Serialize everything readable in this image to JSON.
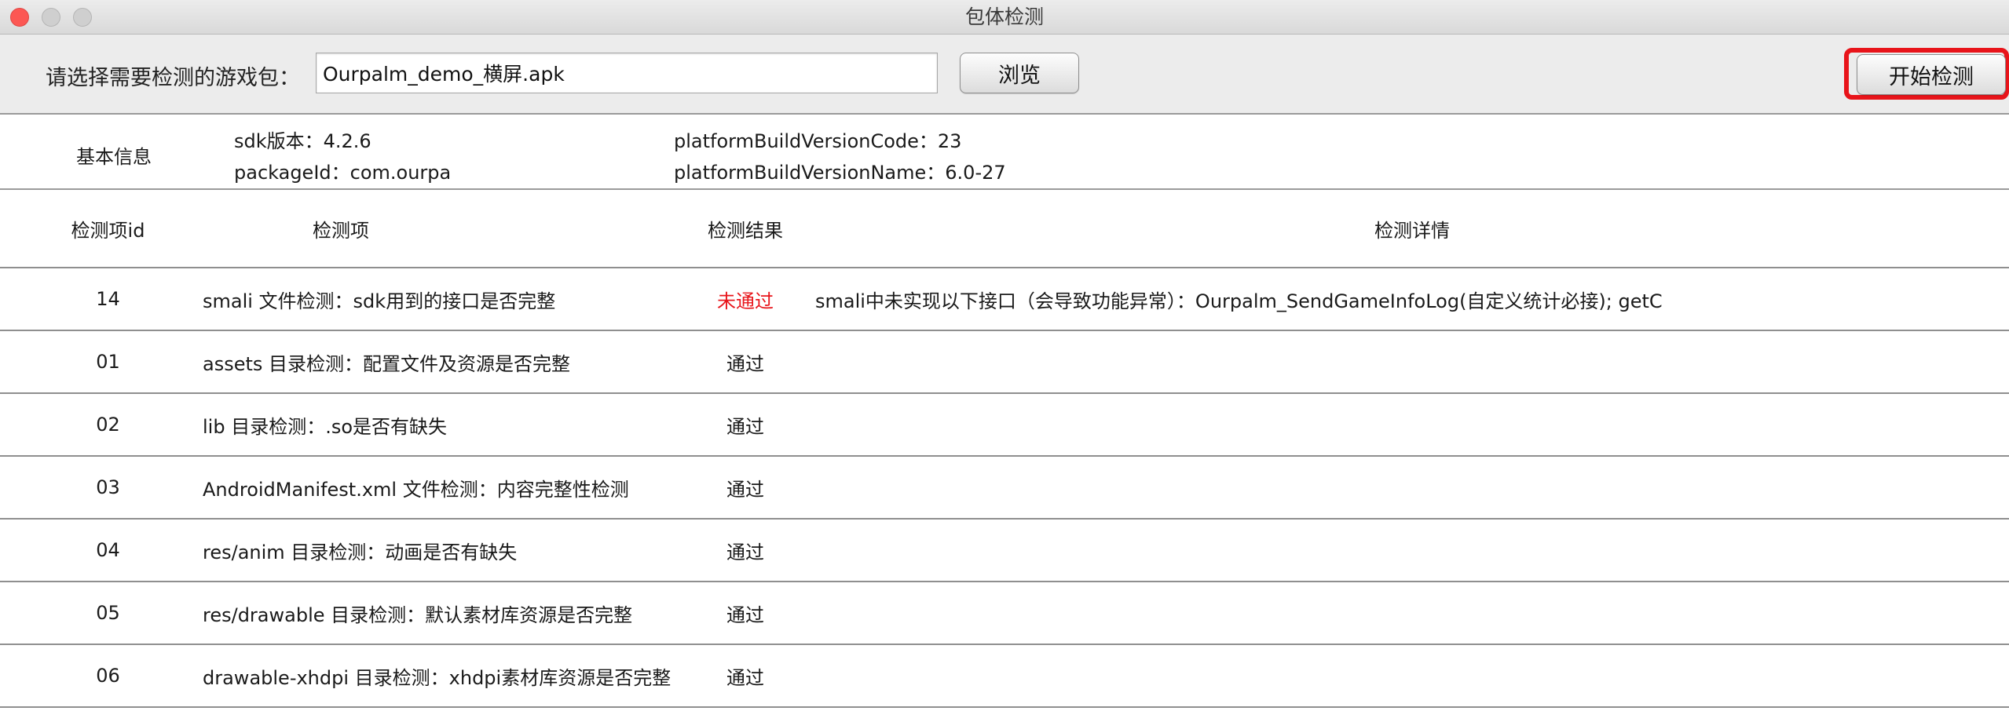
{
  "window": {
    "title": "包体检测"
  },
  "toolbar": {
    "prompt": "请选择需要检测的游戏包：",
    "file_value": "Ourpalm_demo_横屏.apk",
    "browse_label": "浏览",
    "start_label": "开始检测",
    "highlight_color": "#e8141a"
  },
  "info": {
    "label": "基本信息",
    "sdk_version": "sdk版本：4.2.6",
    "package_id": "packageId：com.ourpa",
    "build_version_code": "platformBuildVersionCode：23",
    "build_version_name": "platformBuildVersionName：6.0-27"
  },
  "table": {
    "headers": {
      "id": "检测项id",
      "item": "检测项",
      "result": "检测结果",
      "detail": "检测详情"
    },
    "rows": [
      {
        "id": "14",
        "item": "smali 文件检测：sdk用到的接口是否完整",
        "result": "未通过",
        "detail": "smali中未实现以下接口（会导致功能异常）：Ourpalm_SendGameInfoLog(自定义统计必接); getC"
      },
      {
        "id": "01",
        "item": "assets 目录检测：配置文件及资源是否完整",
        "result": "通过",
        "detail": ""
      },
      {
        "id": "02",
        "item": "lib 目录检测：.so是否有缺失",
        "result": "通过",
        "detail": ""
      },
      {
        "id": "03",
        "item": "AndroidManifest.xml 文件检测：内容完整性检测",
        "result": "通过",
        "detail": ""
      },
      {
        "id": "04",
        "item": "res/anim 目录检测：动画是否有缺失",
        "result": "通过",
        "detail": ""
      },
      {
        "id": "05",
        "item": "res/drawable 目录检测：默认素材库资源是否完整",
        "result": "通过",
        "detail": ""
      },
      {
        "id": "06",
        "item": "drawable-xhdpi 目录检测：xhdpi素材库资源是否完整",
        "result": "通过",
        "detail": ""
      }
    ]
  },
  "colors": {
    "fail": "#e8141a",
    "close_light": "#fc5753"
  }
}
